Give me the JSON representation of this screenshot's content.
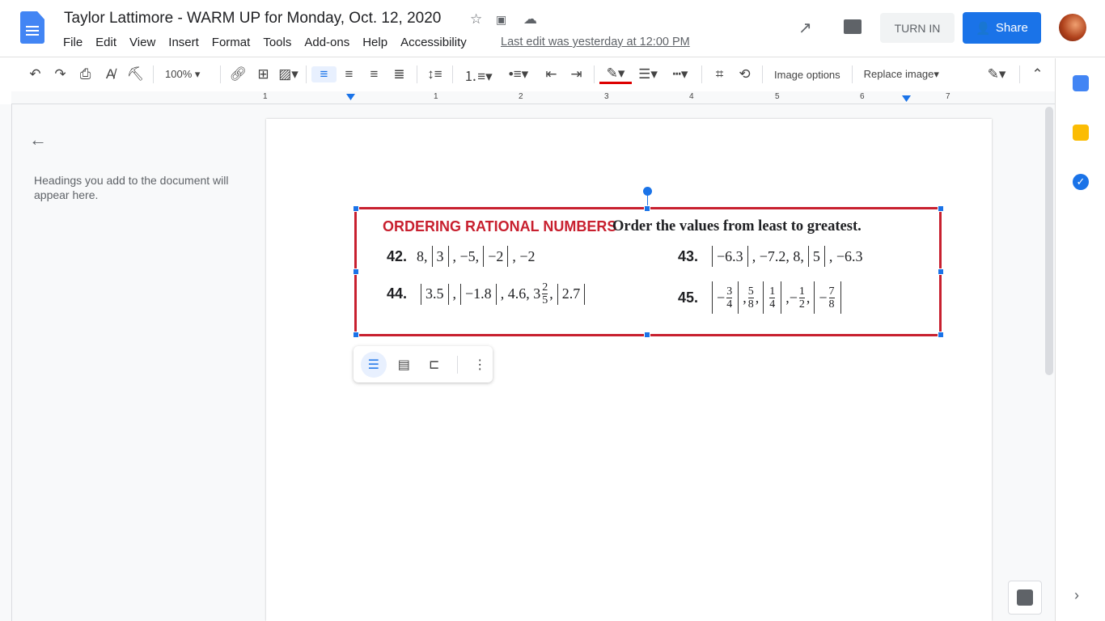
{
  "header": {
    "title": "Taylor Lattimore - WARM UP for Monday, Oct. 12, 2020",
    "last_edit": "Last edit was yesterday at 12:00 PM",
    "turn_in": "TURN IN",
    "share": "Share"
  },
  "menu": [
    "File",
    "Edit",
    "View",
    "Insert",
    "Format",
    "Tools",
    "Add-ons",
    "Help",
    "Accessibility"
  ],
  "toolbar": {
    "zoom": "100%",
    "image_options": "Image options",
    "replace_image": "Replace image"
  },
  "ruler": [
    "1",
    "1",
    "2",
    "3",
    "4",
    "5",
    "6",
    "7"
  ],
  "outline": {
    "empty_text": "Headings you add to the document will appear here."
  },
  "image": {
    "heading": "ORDERING RATIONAL NUMBERS",
    "instruction": "Order the values from least to greatest.",
    "p42": {
      "num": "42.",
      "a": "8,",
      "b": "3",
      ",c": ", −5,",
      "d": "−2",
      "e": ", −2"
    },
    "p43": {
      "num": "43.",
      "a": "−6.3",
      "b": ", −7.2, 8,",
      "c": "5",
      "d": ", −6.3"
    },
    "p44": {
      "num": "44.",
      "a": "3.5",
      "b": ",",
      "c": "−1.8",
      "d": ", 4.6, 3",
      "fn": "2",
      "fd": "5",
      "e": ",",
      "f": "2.7"
    },
    "p45": {
      "num": "45.",
      "a_n": "3",
      "a_d": "4",
      "b_n": "5",
      "b_d": "8",
      "c_n": "1",
      "c_d": "4",
      "d_n": "1",
      "d_d": "2",
      "e_n": "7",
      "e_d": "8",
      "minus": "−",
      "comma": ","
    }
  },
  "colors": {
    "accent": "#1a73e8",
    "heading_red": "#c8202f"
  }
}
